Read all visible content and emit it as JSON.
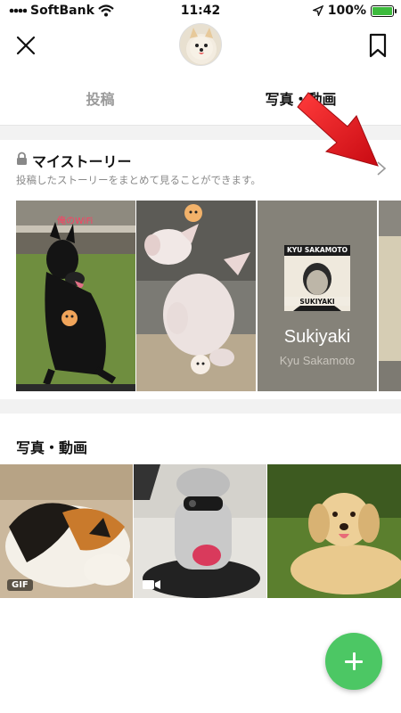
{
  "status_bar": {
    "carrier": "SoftBank",
    "time": "11:42",
    "battery": "100%"
  },
  "header": {
    "close_icon": "close-icon",
    "bookmark_icon": "bookmark-icon"
  },
  "tabs": [
    {
      "label": "投稿",
      "active": false
    },
    {
      "label": "写真・動画",
      "active": true
    }
  ],
  "my_story": {
    "title": "マイストーリー",
    "subtitle": "投稿したストーリーをまとめて見ることができます。",
    "cards": [
      {
        "kind": "photo",
        "subject": "black dog on grass",
        "sticker_text": "俺のWiFi"
      },
      {
        "kind": "photo",
        "subject": "plush pig toy"
      },
      {
        "kind": "music",
        "album_label_top": "KYU SAKAMOTO",
        "album_label_bottom": "SUKIYAKI",
        "song": "Sukiyaki",
        "artist": "Kyu Sakamoto"
      },
      {
        "kind": "photo",
        "subject": "partial card"
      }
    ]
  },
  "photos_section": {
    "title": "写真・動画",
    "items": [
      {
        "subject": "calico cat",
        "badge": "GIF"
      },
      {
        "subject": "robot dog",
        "badge": "video"
      },
      {
        "subject": "golden retriever puppy",
        "badge": ""
      }
    ]
  },
  "fab": {
    "icon": "plus-icon"
  },
  "colors": {
    "accent_green": "#4cc764",
    "annotation_red": "#e8141e"
  }
}
